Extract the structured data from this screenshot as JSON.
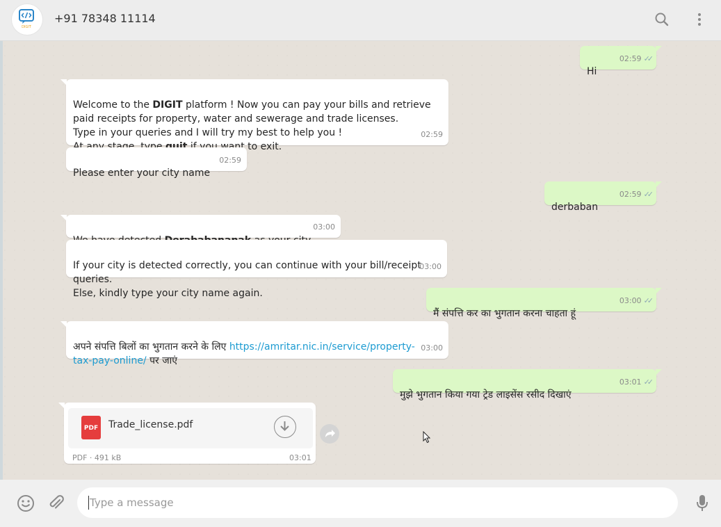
{
  "header": {
    "contact_name": "+91 78348 11114",
    "avatar_logo_text": "DIGIT",
    "icons": [
      "search-icon",
      "menu-icon"
    ]
  },
  "messages": [
    {
      "direction": "out",
      "text": "Hi",
      "time": "02:59",
      "status": "read"
    },
    {
      "direction": "in",
      "text_parts": [
        "Welcome to the ",
        "DIGIT",
        " platform ! Now you can pay your bills and retrieve paid receipts for property, water and sewerage and trade licenses.\nType in your queries and I will try my best to help you !\nAt any stage, type ",
        "quit",
        " if you want to exit."
      ],
      "time": "02:59"
    },
    {
      "direction": "in",
      "text": "Please enter your city name",
      "time": "02:59"
    },
    {
      "direction": "out",
      "text": "derbaban",
      "time": "02:59",
      "status": "read"
    },
    {
      "direction": "in",
      "text_parts": [
        "We have detected ",
        "Derababananak",
        " as your city."
      ],
      "time": "03:00"
    },
    {
      "direction": "in",
      "text": "If your city is detected correctly, you can continue with your bill/receipt queries.\n Else, kindly type your city name again.",
      "time": "03:00"
    },
    {
      "direction": "out",
      "text": "मैं संपत्ति कर का भुगतान करना चाहता हूं",
      "time": "03:00",
      "status": "read"
    },
    {
      "direction": "in",
      "text_parts": [
        "अपने संपत्ति बिलों का भुगतान करने के लिए ",
        "https://amritar.nic.in/service/property-tax-pay-online/",
        " पर जाएं"
      ],
      "time": "03:00"
    },
    {
      "direction": "out",
      "text": "मुझे भुगतान किया गया ट्रेड लाइसेंस रसीद दिखाएं",
      "time": "03:01",
      "status": "read"
    }
  ],
  "attachment": {
    "icon_label": "PDF",
    "file_name": "Trade_license.pdf",
    "meta": "PDF · 491 kB",
    "time": "03:01"
  },
  "composer": {
    "placeholder": "Type a message",
    "icons": [
      "emoji-icon",
      "attach-icon",
      "microphone-icon"
    ]
  },
  "colors": {
    "header_bg": "#ededed",
    "chat_bg": "#e6e1da",
    "incoming_bubble": "#ffffff",
    "outgoing_bubble": "#dcf8c6",
    "link": "#1c9bd1",
    "pdf_icon": "#e53d3d"
  }
}
